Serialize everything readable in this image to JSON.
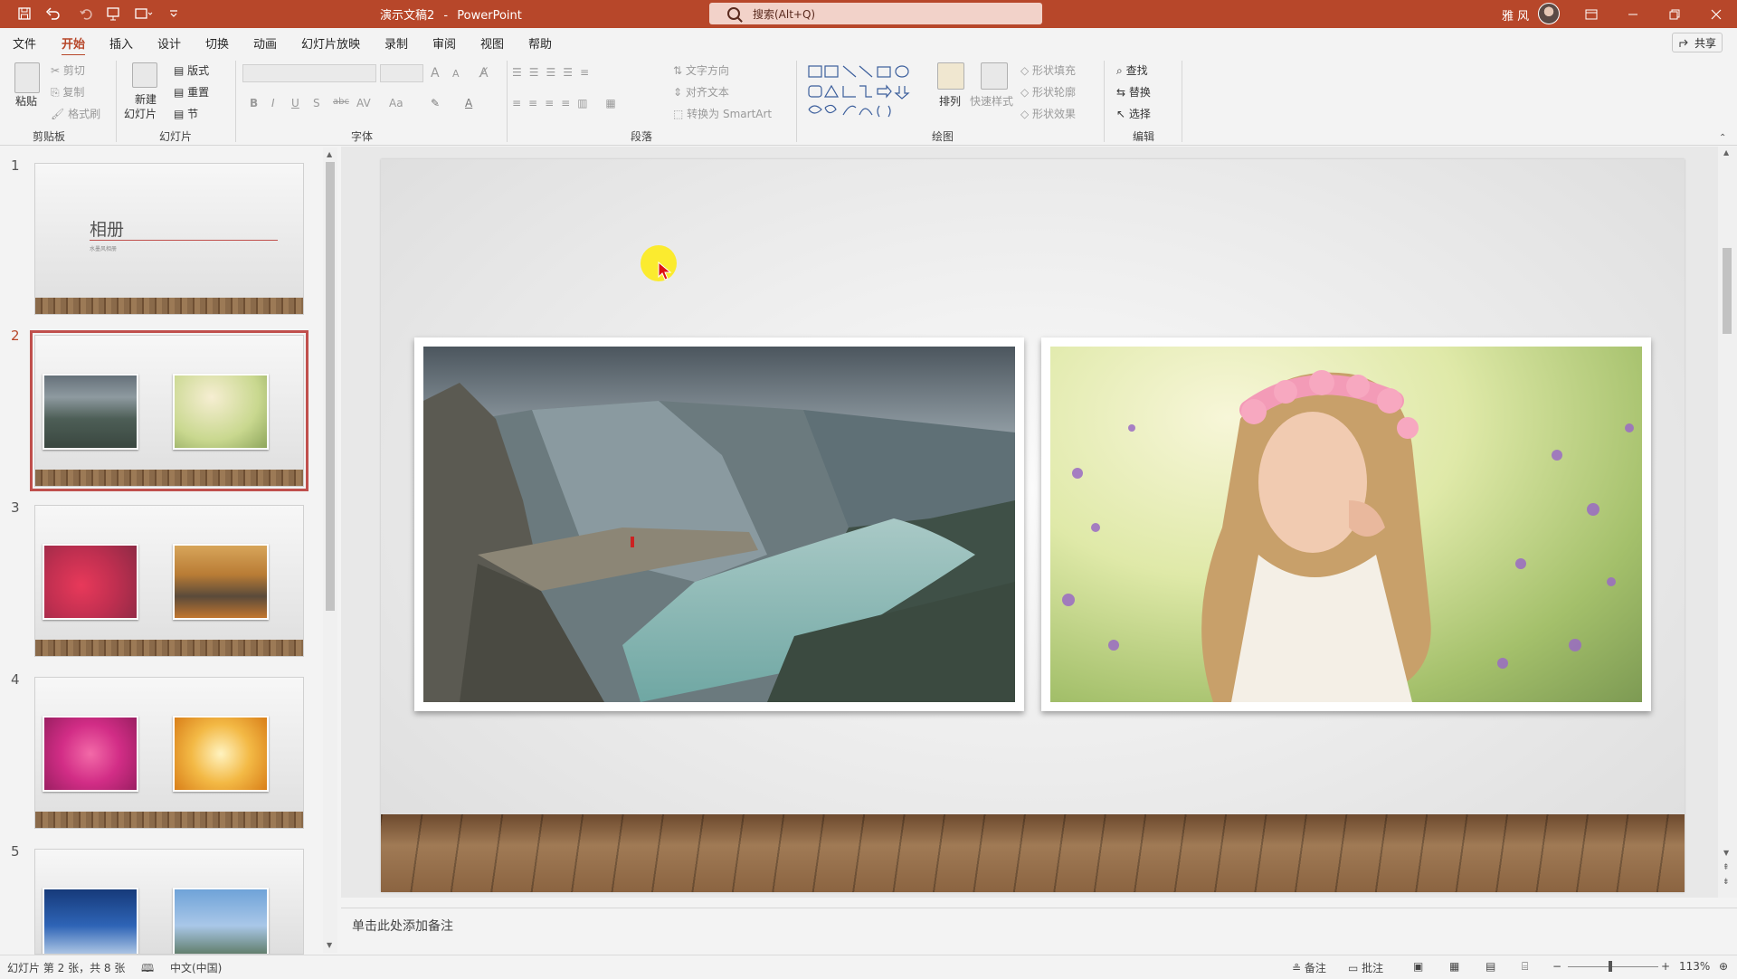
{
  "titlebar": {
    "doc_name": "演示文稿2",
    "separator": "-",
    "app_name": "PowerPoint",
    "search_placeholder": "搜索(Alt+Q)",
    "user_name": "雅 风",
    "accent_color": "#b7472a"
  },
  "menu": {
    "tabs": [
      "文件",
      "开始",
      "插入",
      "设计",
      "切换",
      "动画",
      "幻灯片放映",
      "录制",
      "审阅",
      "视图",
      "帮助"
    ],
    "active_tab": "开始",
    "share_label": "共享"
  },
  "ribbon": {
    "clipboard": {
      "label": "剪贴板",
      "paste": "粘贴",
      "cut": "剪切",
      "copy": "复制",
      "format_painter": "格式刷"
    },
    "slides": {
      "label": "幻灯片",
      "new_slide_1": "新建",
      "new_slide_2": "幻灯片",
      "layout": "版式",
      "reset": "重置",
      "section": "节"
    },
    "font": {
      "label": "字体",
      "bold": "B",
      "italic": "I",
      "underline": "U",
      "shadow": "S",
      "strike": "abc",
      "spacing": "AV",
      "case": "Aa",
      "grow": "A",
      "shrink": "A"
    },
    "paragraph": {
      "label": "段落",
      "text_direction": "文字方向",
      "align_text": "对齐文本",
      "smartart": "转换为 SmartArt"
    },
    "drawing": {
      "label": "绘图",
      "arrange": "排列",
      "quick_styles": "快速样式",
      "shape_fill": "形状填充",
      "shape_outline": "形状轮廓",
      "shape_effects": "形状效果"
    },
    "editing": {
      "label": "编辑",
      "find": "查找",
      "replace": "替换",
      "select": "选择"
    }
  },
  "slides_panel": {
    "selected": 2,
    "slides": [
      {
        "number": "1",
        "title": "相册",
        "subtitle": "水墨风相册"
      },
      {
        "number": "2"
      },
      {
        "number": "3"
      },
      {
        "number": "4"
      },
      {
        "number": "5"
      }
    ]
  },
  "notes": {
    "placeholder": "单击此处添加备注"
  },
  "status": {
    "slide_info": "幻灯片 第 2 张，共 8 张",
    "language": "中文(中国)",
    "notes_btn": "备注",
    "comments_btn": "批注",
    "zoom": "113%",
    "zoom_fraction": 0.47
  }
}
